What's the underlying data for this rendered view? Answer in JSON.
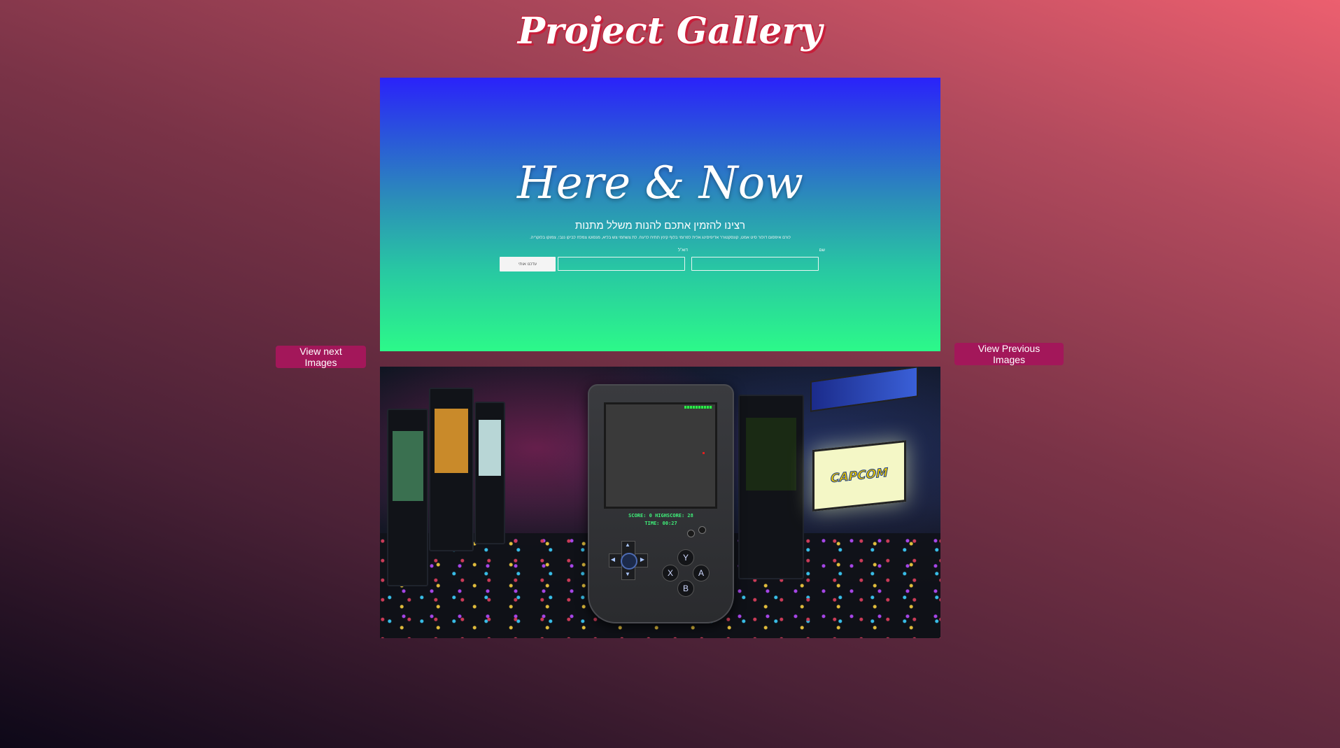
{
  "header": {
    "title": "Project Gallery"
  },
  "nav": {
    "next_label": "View next Images",
    "prev_label": "View Previous Images"
  },
  "slide1": {
    "title": "Here & Now",
    "subtitle": "רצינו להזמין אתכם להנות משלל מתנות",
    "body": "לורם איפסום דולור סיט אמט, קונסקטורר אדיפיסינג אלית לפרומי בלוף קינץ תתיח לרעח. לת צשחמי צש בליא, מנסוטו צמלח לביקו ננבי, צמוקו בלוקריה.",
    "name_label": "שם",
    "email_label": "דוא\"ל",
    "name_value": "",
    "email_value": "",
    "submit_label": "עדכנו אותי",
    "gradient": [
      "#2a22fa",
      "#2cf989"
    ]
  },
  "slide2": {
    "score_line": "SCORE: 0 HIGHSCORE: 28",
    "time_line": "TIME: 00:27",
    "buttons": {
      "y": "Y",
      "x": "X",
      "a": "A",
      "b": "B"
    },
    "cabinet_logo": "CAPCOM"
  },
  "colors": {
    "title_shadow": "#c81e3a",
    "nav_button": "#a3175a",
    "lcd_text": "#3ff07a"
  }
}
